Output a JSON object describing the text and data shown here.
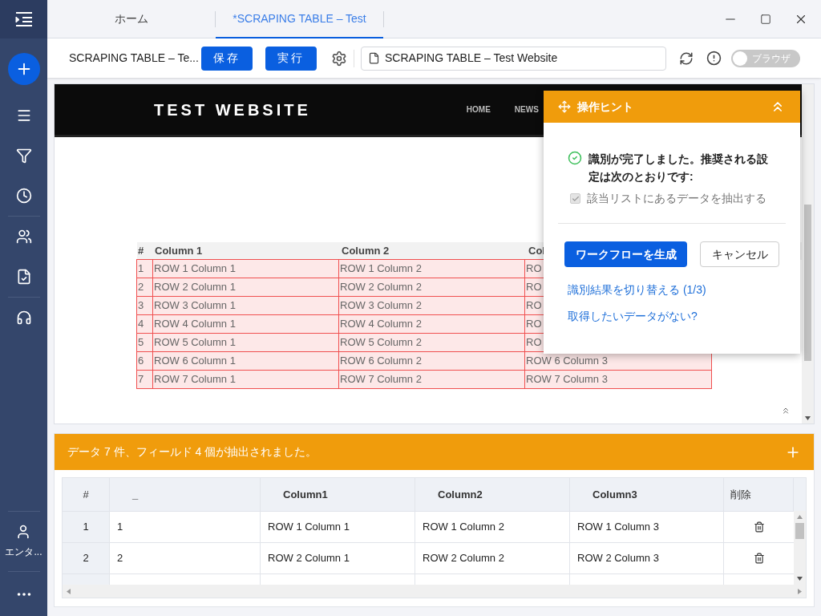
{
  "sidebar": {
    "user_label": "エンタ..."
  },
  "tabs": [
    {
      "label": "ホーム",
      "selected": false
    },
    {
      "label": "*SCRAPING TABLE – Test",
      "selected": true
    }
  ],
  "toolbar": {
    "title": "SCRAPING TABLE – Te...",
    "save": "保存",
    "run": "実行",
    "address": "SCRAPING TABLE – Test Website",
    "browser_toggle": {
      "label": "ブラウザ",
      "on": false
    }
  },
  "website": {
    "title": "TEST WEBSITE",
    "nav": [
      "HOME",
      "NEWS"
    ],
    "table": {
      "columns": [
        "#",
        "Column 1",
        "Column 2",
        "Col"
      ],
      "rows": [
        [
          "1",
          "ROW 1 Column 1",
          "ROW 1 Column 2",
          "RO"
        ],
        [
          "2",
          "ROW 2 Column 1",
          "ROW 2 Column 2",
          "RO"
        ],
        [
          "3",
          "ROW 3 Column 1",
          "ROW 3 Column 2",
          "RO"
        ],
        [
          "4",
          "ROW 4 Column 1",
          "ROW 4 Column 2",
          "RO"
        ],
        [
          "5",
          "ROW 5 Column 1",
          "ROW 5 Column 2",
          "RO"
        ],
        [
          "6",
          "ROW 6 Column 1",
          "ROW 6 Column 2",
          "ROW 6 Column 3"
        ],
        [
          "7",
          "ROW 7 Column 1",
          "ROW 7 Column 2",
          "ROW 7 Column 3"
        ]
      ]
    }
  },
  "hint": {
    "title": "操作ヒント",
    "message": "識別が完了しました。推奨される設定は次のとおりです:",
    "option": {
      "label": "該当リストにあるデータを抽出する",
      "checked": true,
      "disabled": true
    },
    "primary": "ワークフローを生成",
    "cancel": "キャンセル",
    "links": [
      "識別結果を切り替える (1/3)",
      "取得したいデータがない?"
    ]
  },
  "extract": {
    "summary": "データ 7 件、フィールド 4 個が抽出されました。",
    "columns": [
      "#",
      "_",
      "Column1",
      "Column2",
      "Column3",
      "削除"
    ],
    "rows": [
      [
        "1",
        "1",
        "ROW 1 Column 1",
        "ROW 1 Column 2",
        "ROW 1 Column 3"
      ],
      [
        "2",
        "2",
        "ROW 2 Column 1",
        "ROW 2 Column 2",
        "ROW 2 Column 3"
      ]
    ]
  }
}
